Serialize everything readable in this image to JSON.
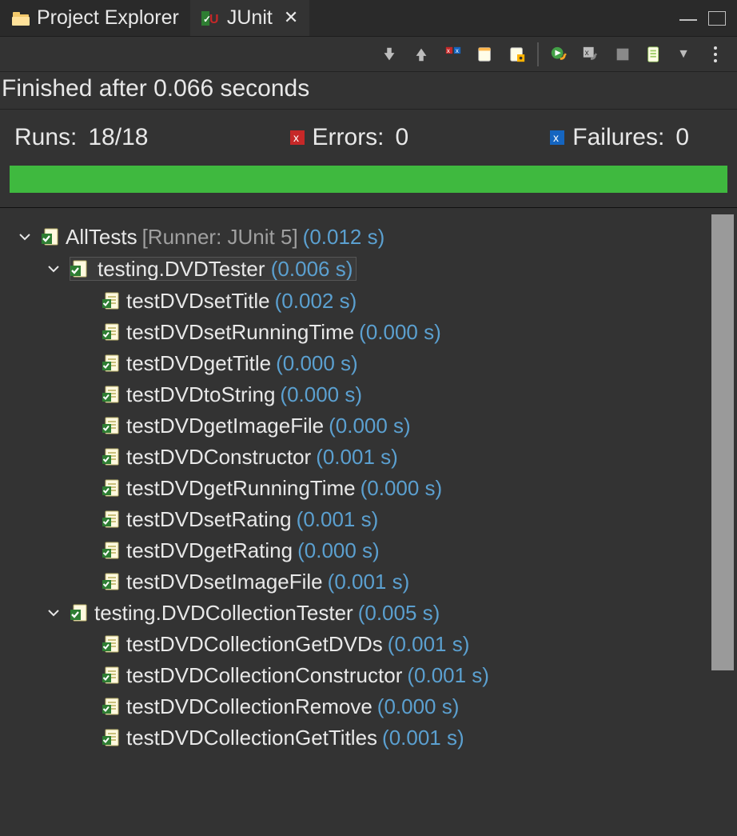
{
  "tabs": {
    "project_explorer": "Project Explorer",
    "junit": "JUnit"
  },
  "toolbar_icons": [
    "next-failure-icon",
    "prev-failure-icon",
    "show-failures-icon",
    "scroll-lock-icon",
    "pin-icon",
    "rerun-icon",
    "rerun-failed-icon",
    "stop-icon",
    "history-icon",
    "view-menu-dropdown-icon",
    "kebab-icon"
  ],
  "status_line": "Finished after 0.066 seconds",
  "counters": {
    "runs_label": "Runs:",
    "runs_value": "18/18",
    "errors_label": "Errors:",
    "errors_value": "0",
    "failures_label": "Failures:",
    "failures_value": "0"
  },
  "tree": {
    "root": {
      "name": "AllTests",
      "meta": "[Runner: JUnit 5]",
      "time": "(0.012 s)",
      "children": [
        {
          "name": "testing.DVDTester",
          "time": "(0.006 s)",
          "selected": true,
          "children": [
            {
              "name": "testDVDsetTitle",
              "time": "(0.002 s)"
            },
            {
              "name": "testDVDsetRunningTime",
              "time": "(0.000 s)"
            },
            {
              "name": "testDVDgetTitle",
              "time": "(0.000 s)"
            },
            {
              "name": "testDVDtoString",
              "time": "(0.000 s)"
            },
            {
              "name": "testDVDgetImageFile",
              "time": "(0.000 s)"
            },
            {
              "name": "testDVDConstructor",
              "time": "(0.001 s)"
            },
            {
              "name": "testDVDgetRunningTime",
              "time": "(0.000 s)"
            },
            {
              "name": "testDVDsetRating",
              "time": "(0.001 s)"
            },
            {
              "name": "testDVDgetRating",
              "time": "(0.000 s)"
            },
            {
              "name": "testDVDsetImageFile",
              "time": "(0.001 s)"
            }
          ]
        },
        {
          "name": "testing.DVDCollectionTester",
          "time": "(0.005 s)",
          "children": [
            {
              "name": "testDVDCollectionGetDVDs",
              "time": "(0.001 s)"
            },
            {
              "name": "testDVDCollectionConstructor",
              "time": "(0.001 s)"
            },
            {
              "name": "testDVDCollectionRemove",
              "time": "(0.000 s)"
            },
            {
              "name": "testDVDCollectionGetTitles",
              "time": "(0.001 s)"
            }
          ]
        }
      ]
    }
  }
}
